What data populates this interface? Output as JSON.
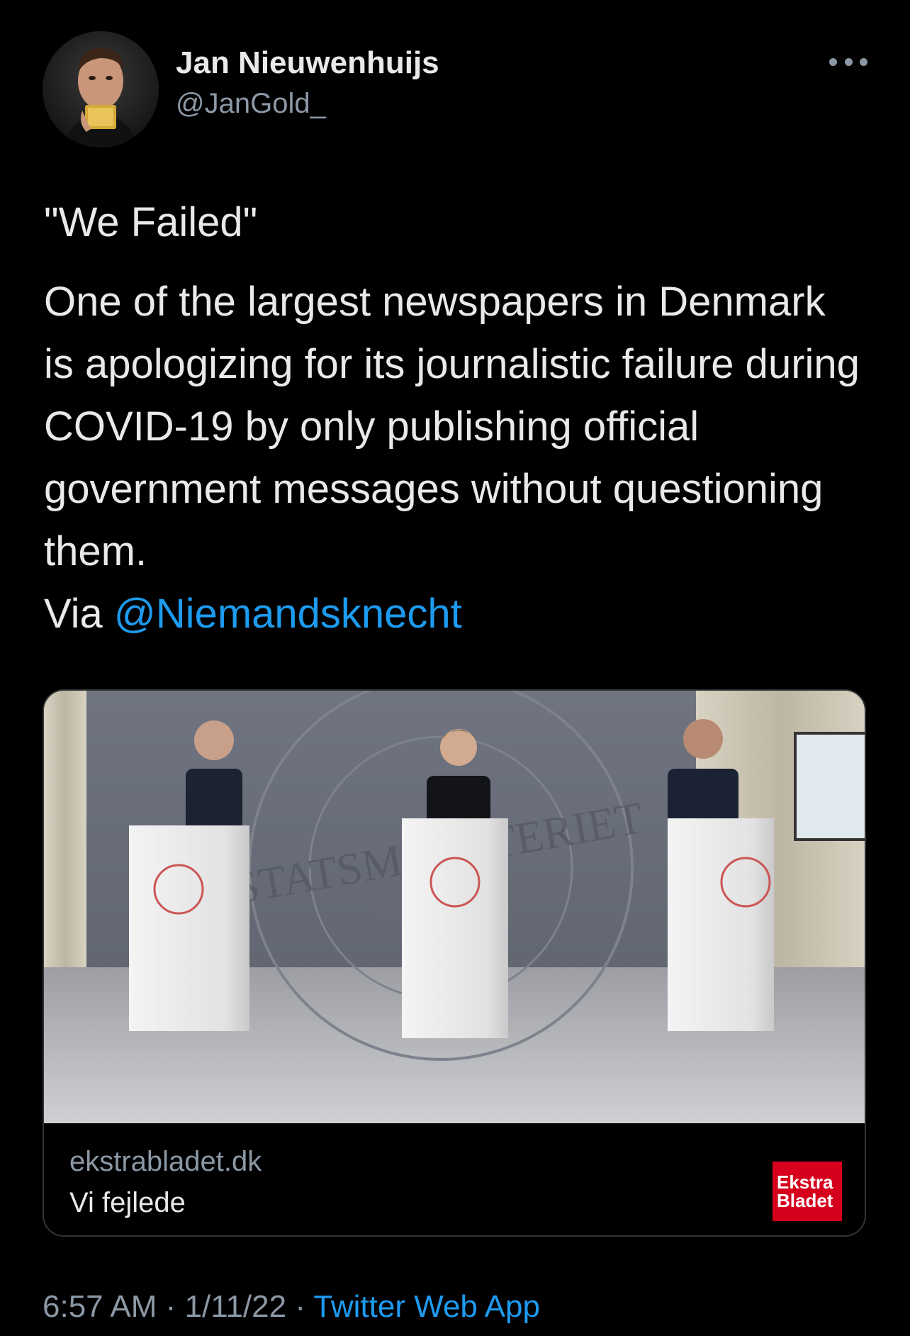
{
  "author": {
    "name": "Jan Nieuwenhuijs",
    "handle": "@JanGold_"
  },
  "tweet": {
    "headline": "\"We Failed\"",
    "body": "One of the largest newspapers in Denmark is apologizing for its journalistic failure during COVID-19 by only publishing official government messages without questioning them.",
    "via_prefix": "Via ",
    "mention": "@Niemandsknecht"
  },
  "link_card": {
    "domain": "ekstrabladet.dk",
    "title": "Vi fejlede",
    "image_alt": "Press conference at Statsministeriet with three speakers at white podiums",
    "backdrop_text": "STATSMINISTERIET",
    "badge_line1": "Ekstra",
    "badge_line2": "Bladet"
  },
  "meta": {
    "time": "6:57 AM",
    "date": "1/11/22",
    "separator": " · ",
    "source": "Twitter Web App"
  },
  "colors": {
    "background": "#000000",
    "text": "#e7e9ea",
    "secondary": "#8b98a5",
    "link": "#1d9bf0",
    "badge": "#d6001c"
  },
  "icons": {
    "more": "more-options-icon"
  }
}
